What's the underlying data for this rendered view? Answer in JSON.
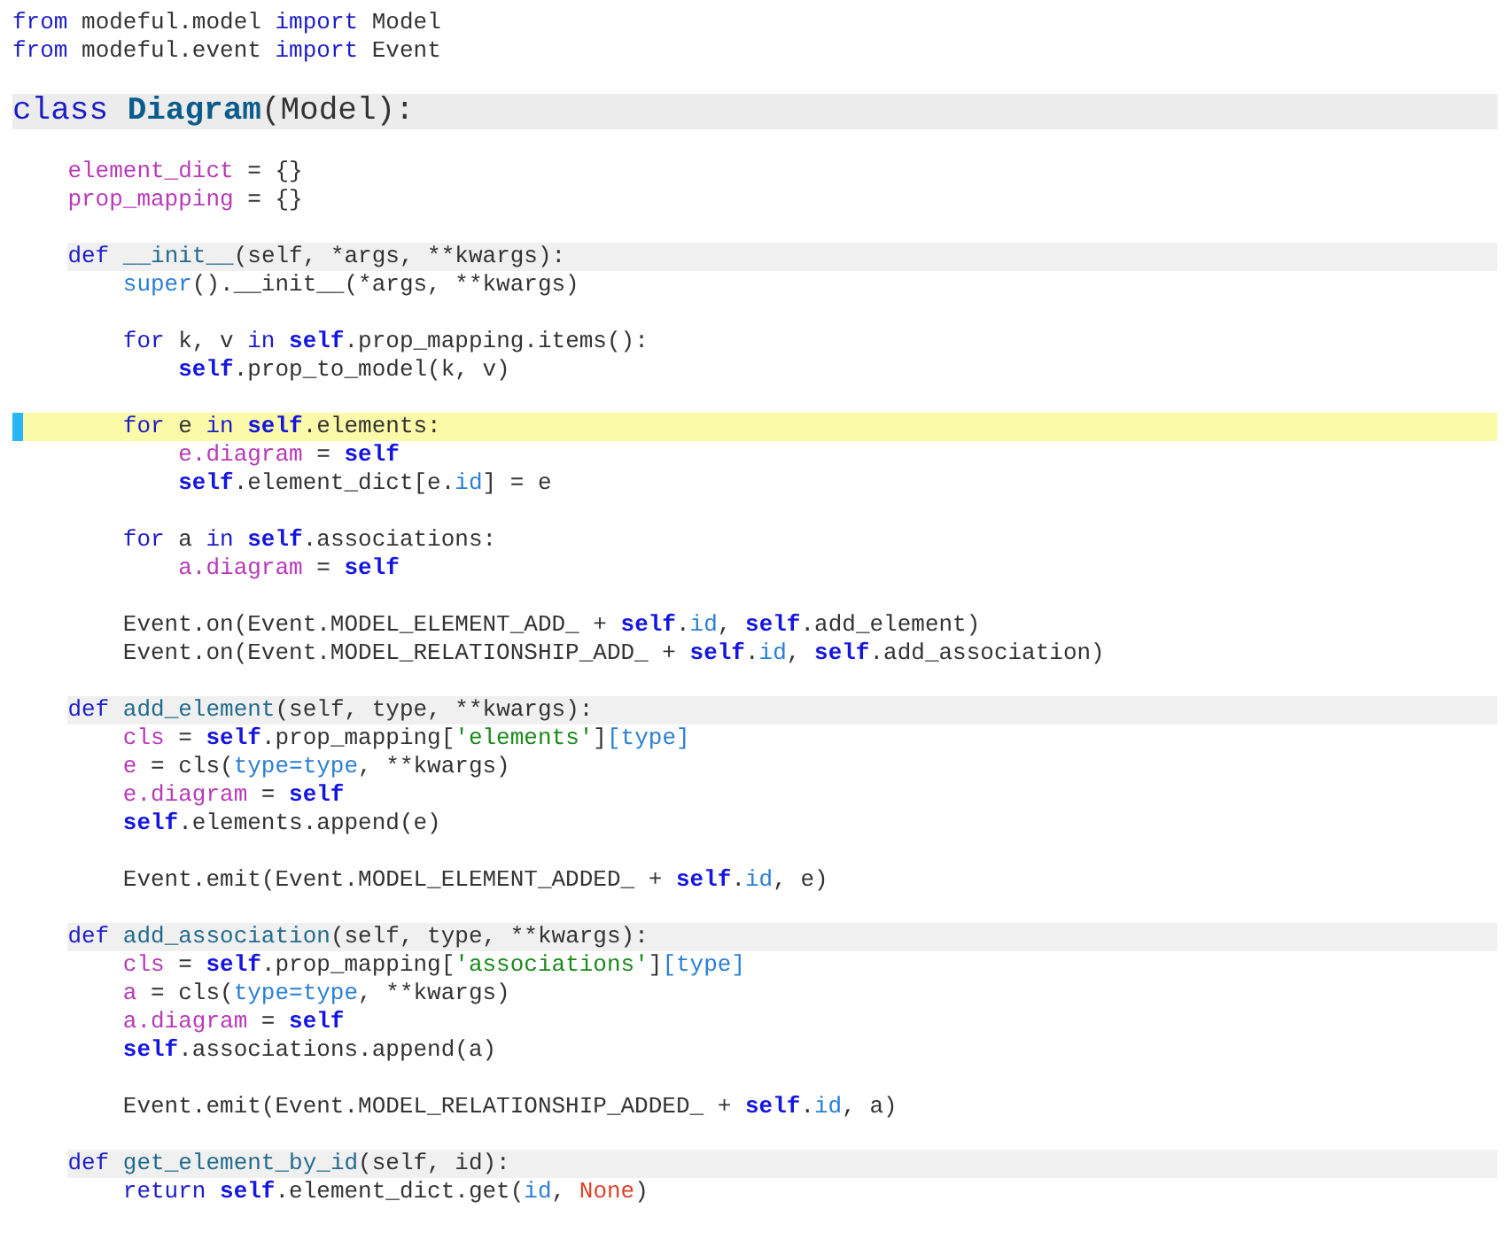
{
  "editor": {
    "lines": [
      {
        "kind": "plain",
        "tokens": [
          {
            "kind": "keyword",
            "text": "from"
          },
          {
            "kind": "plain",
            "text": " modeful.model "
          },
          {
            "kind": "keyword",
            "text": "import"
          },
          {
            "kind": "plain",
            "text": " Model"
          }
        ]
      },
      {
        "kind": "plain",
        "tokens": [
          {
            "kind": "keyword",
            "text": "from"
          },
          {
            "kind": "plain",
            "text": " modeful.event "
          },
          {
            "kind": "keyword",
            "text": "import"
          },
          {
            "kind": "plain",
            "text": " Event"
          }
        ]
      },
      {
        "kind": "blank"
      },
      {
        "kind": "class",
        "tokens": [
          {
            "kind": "keyword",
            "text": "class "
          },
          {
            "kind": "classname",
            "text": "Diagram"
          },
          {
            "kind": "plain",
            "text": "(Model):"
          }
        ],
        "children": [
          {
            "kind": "blank"
          },
          {
            "kind": "plain",
            "tokens": [
              {
                "kind": "variable",
                "text": "element_dict"
              },
              {
                "kind": "plain",
                "text": " = {}"
              }
            ]
          },
          {
            "kind": "plain",
            "tokens": [
              {
                "kind": "variable",
                "text": "prop_mapping"
              },
              {
                "kind": "plain",
                "text": " = {}"
              }
            ]
          },
          {
            "kind": "blank"
          },
          {
            "kind": "def",
            "tokens": [
              {
                "kind": "keyword",
                "text": "def "
              },
              {
                "kind": "function",
                "text": "__init__"
              },
              {
                "kind": "plain",
                "text": "(self, *args, **kwargs):"
              }
            ],
            "children": [
              {
                "kind": "plain",
                "tokens": [
                  {
                    "kind": "builtin",
                    "text": "super"
                  },
                  {
                    "kind": "plain",
                    "text": "().__init__(*args, **kwargs)"
                  }
                ]
              },
              {
                "kind": "blank"
              },
              {
                "kind": "plain",
                "tokens": [
                  {
                    "kind": "keyword",
                    "text": "for"
                  },
                  {
                    "kind": "plain",
                    "text": " k, v "
                  },
                  {
                    "kind": "keyword",
                    "text": "in "
                  },
                  {
                    "kind": "self",
                    "text": "self"
                  },
                  {
                    "kind": "plain",
                    "text": ".prop_mapping.items():"
                  }
                ],
                "children": [
                  {
                    "kind": "plain",
                    "tokens": [
                      {
                        "kind": "self",
                        "text": "self"
                      },
                      {
                        "kind": "plain",
                        "text": ".prop_to_model(k, v)"
                      }
                    ]
                  }
                ]
              },
              {
                "kind": "blank"
              },
              {
                "kind": "current",
                "tokens": [
                  {
                    "kind": "keyword",
                    "text": "for"
                  },
                  {
                    "kind": "plain",
                    "text": " e "
                  },
                  {
                    "kind": "keyword",
                    "text": "in "
                  },
                  {
                    "kind": "self",
                    "text": "self"
                  },
                  {
                    "kind": "plain",
                    "text": ".elements:"
                  }
                ],
                "children": [
                  {
                    "kind": "plain",
                    "tokens": [
                      {
                        "kind": "variable",
                        "text": "e.diagram"
                      },
                      {
                        "kind": "plain",
                        "text": " = "
                      },
                      {
                        "kind": "self",
                        "text": "self"
                      }
                    ]
                  },
                  {
                    "kind": "plain",
                    "tokens": [
                      {
                        "kind": "self",
                        "text": "self"
                      },
                      {
                        "kind": "plain",
                        "text": ".element_dict[e."
                      },
                      {
                        "kind": "builtin",
                        "text": "id"
                      },
                      {
                        "kind": "plain",
                        "text": "] = e"
                      }
                    ]
                  }
                ]
              },
              {
                "kind": "blank"
              },
              {
                "kind": "plain",
                "tokens": [
                  {
                    "kind": "keyword",
                    "text": "for"
                  },
                  {
                    "kind": "plain",
                    "text": " a "
                  },
                  {
                    "kind": "keyword",
                    "text": "in "
                  },
                  {
                    "kind": "self",
                    "text": "self"
                  },
                  {
                    "kind": "plain",
                    "text": ".associations:"
                  }
                ],
                "children": [
                  {
                    "kind": "plain",
                    "tokens": [
                      {
                        "kind": "variable",
                        "text": "a.diagram"
                      },
                      {
                        "kind": "plain",
                        "text": " = "
                      },
                      {
                        "kind": "self",
                        "text": "self"
                      }
                    ]
                  }
                ]
              },
              {
                "kind": "blank"
              },
              {
                "kind": "plain",
                "tokens": [
                  {
                    "kind": "plain",
                    "text": "Event.on(Event.MODEL_ELEMENT_ADD_ + "
                  },
                  {
                    "kind": "self",
                    "text": "self"
                  },
                  {
                    "kind": "plain",
                    "text": "."
                  },
                  {
                    "kind": "builtin",
                    "text": "id"
                  },
                  {
                    "kind": "plain",
                    "text": ", "
                  },
                  {
                    "kind": "self",
                    "text": "self"
                  },
                  {
                    "kind": "plain",
                    "text": ".add_element)"
                  }
                ]
              },
              {
                "kind": "plain",
                "tokens": [
                  {
                    "kind": "plain",
                    "text": "Event.on(Event.MODEL_RELATIONSHIP_ADD_ + "
                  },
                  {
                    "kind": "self",
                    "text": "self"
                  },
                  {
                    "kind": "plain",
                    "text": "."
                  },
                  {
                    "kind": "builtin",
                    "text": "id"
                  },
                  {
                    "kind": "plain",
                    "text": ", "
                  },
                  {
                    "kind": "self",
                    "text": "self"
                  },
                  {
                    "kind": "plain",
                    "text": ".add_association)"
                  }
                ]
              }
            ]
          },
          {
            "kind": "blank"
          },
          {
            "kind": "def",
            "tokens": [
              {
                "kind": "keyword",
                "text": "def "
              },
              {
                "kind": "function",
                "text": "add_element"
              },
              {
                "kind": "plain",
                "text": "(self, type, **kwargs):"
              }
            ],
            "children": [
              {
                "kind": "plain",
                "tokens": [
                  {
                    "kind": "variable",
                    "text": "cls"
                  },
                  {
                    "kind": "plain",
                    "text": " = "
                  },
                  {
                    "kind": "self",
                    "text": "self"
                  },
                  {
                    "kind": "plain",
                    "text": ".prop_mapping["
                  },
                  {
                    "kind": "string",
                    "text": "'elements'"
                  },
                  {
                    "kind": "plain",
                    "text": "]"
                  },
                  {
                    "kind": "builtin",
                    "text": "[type]"
                  }
                ]
              },
              {
                "kind": "plain",
                "tokens": [
                  {
                    "kind": "variable",
                    "text": "e"
                  },
                  {
                    "kind": "plain",
                    "text": " = cls("
                  },
                  {
                    "kind": "builtin",
                    "text": "type=type"
                  },
                  {
                    "kind": "plain",
                    "text": ", **kwargs)"
                  }
                ]
              },
              {
                "kind": "plain",
                "tokens": [
                  {
                    "kind": "variable",
                    "text": "e.diagram"
                  },
                  {
                    "kind": "plain",
                    "text": " = "
                  },
                  {
                    "kind": "self",
                    "text": "self"
                  }
                ]
              },
              {
                "kind": "plain",
                "tokens": [
                  {
                    "kind": "self",
                    "text": "self"
                  },
                  {
                    "kind": "plain",
                    "text": ".elements.append(e)"
                  }
                ]
              },
              {
                "kind": "blank"
              },
              {
                "kind": "plain",
                "tokens": [
                  {
                    "kind": "plain",
                    "text": "Event.emit(Event.MODEL_ELEMENT_ADDED_ + "
                  },
                  {
                    "kind": "self",
                    "text": "self"
                  },
                  {
                    "kind": "plain",
                    "text": "."
                  },
                  {
                    "kind": "builtin",
                    "text": "id"
                  },
                  {
                    "kind": "plain",
                    "text": ", e)"
                  }
                ]
              }
            ]
          },
          {
            "kind": "blank"
          },
          {
            "kind": "def",
            "tokens": [
              {
                "kind": "keyword",
                "text": "def "
              },
              {
                "kind": "function",
                "text": "add_association"
              },
              {
                "kind": "plain",
                "text": "(self, type, **kwargs):"
              }
            ],
            "children": [
              {
                "kind": "plain",
                "tokens": [
                  {
                    "kind": "variable",
                    "text": "cls"
                  },
                  {
                    "kind": "plain",
                    "text": " = "
                  },
                  {
                    "kind": "self",
                    "text": "self"
                  },
                  {
                    "kind": "plain",
                    "text": ".prop_mapping["
                  },
                  {
                    "kind": "string",
                    "text": "'associations'"
                  },
                  {
                    "kind": "plain",
                    "text": "]"
                  },
                  {
                    "kind": "builtin",
                    "text": "[type]"
                  }
                ]
              },
              {
                "kind": "plain",
                "tokens": [
                  {
                    "kind": "variable",
                    "text": "a"
                  },
                  {
                    "kind": "plain",
                    "text": " = cls("
                  },
                  {
                    "kind": "builtin",
                    "text": "type=type"
                  },
                  {
                    "kind": "plain",
                    "text": ", **kwargs)"
                  }
                ]
              },
              {
                "kind": "plain",
                "tokens": [
                  {
                    "kind": "variable",
                    "text": "a.diagram"
                  },
                  {
                    "kind": "plain",
                    "text": " = "
                  },
                  {
                    "kind": "self",
                    "text": "self"
                  }
                ]
              },
              {
                "kind": "plain",
                "tokens": [
                  {
                    "kind": "self",
                    "text": "self"
                  },
                  {
                    "kind": "plain",
                    "text": ".associations.append(a)"
                  }
                ]
              },
              {
                "kind": "blank"
              },
              {
                "kind": "plain",
                "tokens": [
                  {
                    "kind": "plain",
                    "text": "Event.emit(Event.MODEL_RELATIONSHIP_ADDED_ + "
                  },
                  {
                    "kind": "self",
                    "text": "self"
                  },
                  {
                    "kind": "plain",
                    "text": "."
                  },
                  {
                    "kind": "builtin",
                    "text": "id"
                  },
                  {
                    "kind": "plain",
                    "text": ", a)"
                  }
                ]
              }
            ]
          },
          {
            "kind": "blank"
          },
          {
            "kind": "def",
            "tokens": [
              {
                "kind": "keyword",
                "text": "def "
              },
              {
                "kind": "function",
                "text": "get_element_by_id"
              },
              {
                "kind": "plain",
                "text": "(self, id):"
              }
            ],
            "children": [
              {
                "kind": "plain",
                "tokens": [
                  {
                    "kind": "keyword",
                    "text": "return "
                  },
                  {
                    "kind": "self",
                    "text": "self"
                  },
                  {
                    "kind": "plain",
                    "text": ".element_dict.get("
                  },
                  {
                    "kind": "builtin",
                    "text": "id"
                  },
                  {
                    "kind": "plain",
                    "text": ", "
                  },
                  {
                    "kind": "constant",
                    "text": "None"
                  },
                  {
                    "kind": "plain",
                    "text": ")"
                  }
                ]
              }
            ]
          }
        ]
      }
    ]
  }
}
